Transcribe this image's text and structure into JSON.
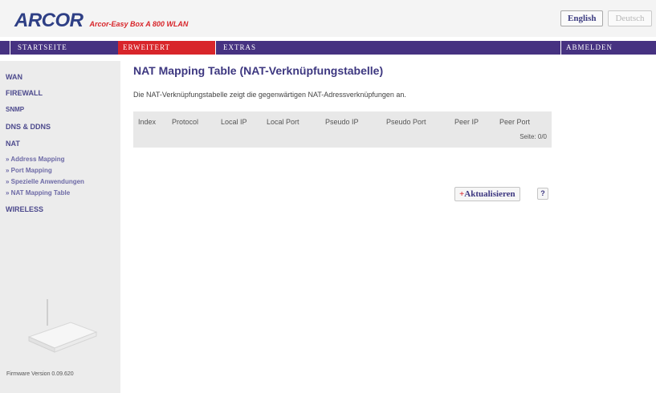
{
  "header": {
    "logo": "ARCOR",
    "tagline": "Arcor-Easy Box A 800 WLAN",
    "lang_english": "English",
    "lang_german": "Deutsch"
  },
  "nav": {
    "home": "STARTSEITE",
    "advanced": "ERWEITERT",
    "extras": "EXTRAS",
    "logout": "ABMELDEN"
  },
  "sidebar": {
    "items": [
      "WAN",
      "FIREWALL",
      "SNMP",
      "DNS & DDNS",
      "NAT"
    ],
    "nat_sub": [
      "» Address Mapping",
      "» Port Mapping",
      "» Spezielle Anwendungen",
      "» NAT Mapping Table"
    ],
    "wireless": "WIRELESS",
    "firmware": "Firmware Version 0.09.620"
  },
  "main": {
    "title": "NAT Mapping Table (NAT-Verknüpfungstabelle)",
    "description": "Die NAT-Verknüpfungstabelle zeigt die gegenwärtigen NAT-Adressverknüpfungen an.",
    "columns": [
      "Index",
      "Protocol",
      "Local IP",
      "Local Port",
      "Pseudo IP",
      "Pseudo Port",
      "Peer IP",
      "Peer Port"
    ],
    "page_info": "Seite: 0/0",
    "refresh": "Aktualisieren",
    "help": "?"
  },
  "colors": {
    "nav_purple": "#463281",
    "accent_red": "#d8252a",
    "brand_blue": "#2e3f85"
  }
}
